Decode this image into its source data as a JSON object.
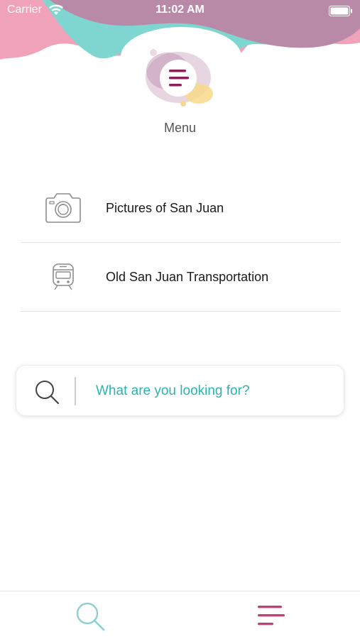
{
  "status_bar": {
    "carrier": "Carrier",
    "time": "11:02 AM",
    "wifi_icon": "wifi-icon",
    "battery_icon": "battery-icon"
  },
  "header": {
    "logo_icon": "menu-lines-icon",
    "title": "Menu",
    "colors": {
      "pink": "#f0a3b8",
      "teal": "#7fd6d0",
      "mauve": "#b98aa8",
      "yellow": "#f7d98a",
      "plum": "#8a1f5c"
    }
  },
  "menu": {
    "items": [
      {
        "label": "Pictures of San Juan",
        "icon": "camera-icon"
      },
      {
        "label": "Old San Juan Transportation",
        "icon": "train-icon"
      }
    ]
  },
  "search": {
    "placeholder": "What are you looking for?",
    "value": "",
    "icon": "search-icon",
    "accent": "#2bb3b1"
  },
  "tab_bar": {
    "tabs": [
      {
        "name": "search",
        "icon": "search-icon",
        "color": "#8fcfd3"
      },
      {
        "name": "menu",
        "icon": "menu-lines-icon",
        "color": "#c2407a",
        "active": true
      }
    ]
  }
}
